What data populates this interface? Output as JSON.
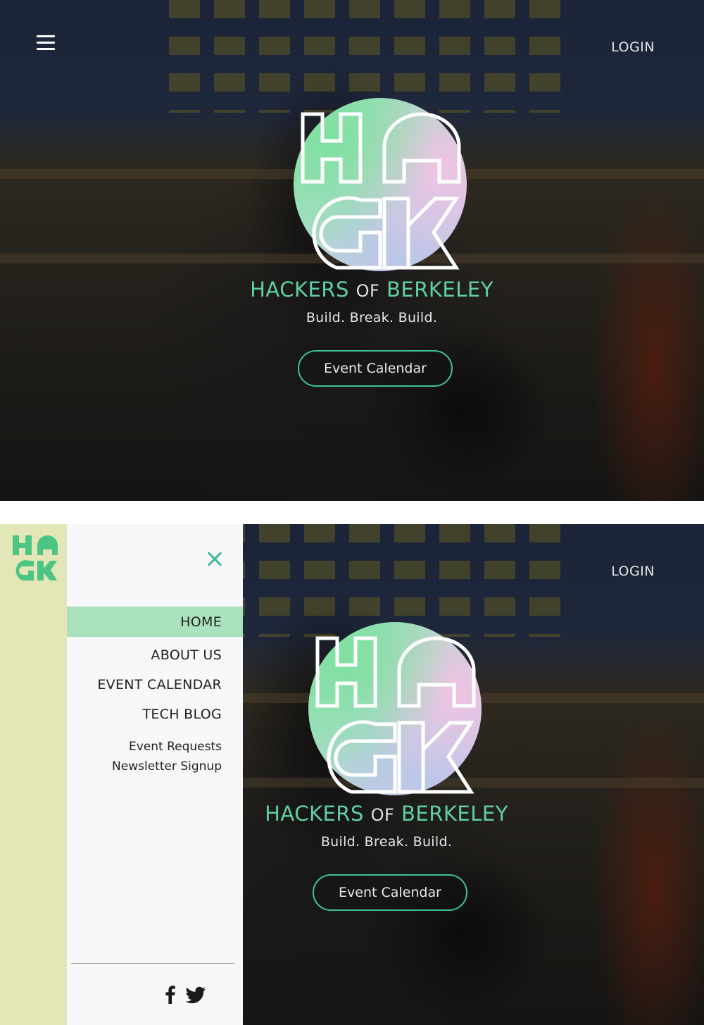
{
  "hero": {
    "login_label": "LOGIN",
    "title_word1": "HACKERS",
    "title_word2": "OF",
    "title_word3": "BERKELEY",
    "tagline": "Build. Break. Build.",
    "cta_label": "Event Calendar"
  },
  "nav": {
    "items": [
      {
        "label": "HOME",
        "active": true
      },
      {
        "label": "ABOUT US"
      },
      {
        "label": "EVENT CALENDAR"
      },
      {
        "label": "TECH BLOG"
      }
    ],
    "sub_items": [
      {
        "label": "Event Requests"
      },
      {
        "label": "Newsletter Signup"
      }
    ],
    "social_icons": [
      "facebook-icon",
      "twitter-icon"
    ]
  },
  "colors": {
    "accent_green": "#3ec29a",
    "title_green": "#5fd0a5",
    "nav_active_bg": "#a9e2bd",
    "rail_bg": "#e3e6b6",
    "drawer_bg": "#f8f7f9",
    "logo_green": "#4cc584"
  }
}
